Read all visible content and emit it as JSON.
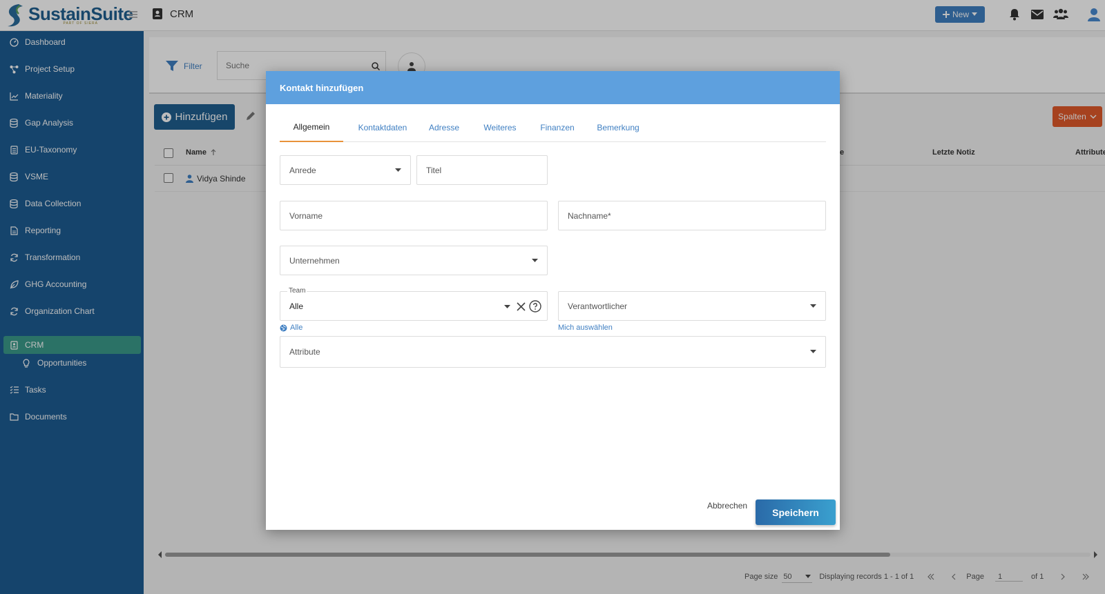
{
  "app": {
    "name": "SustainSuite",
    "tagline": "PART OF SIERA"
  },
  "header": {
    "module": "CRM",
    "new_label": "New"
  },
  "sidebar": {
    "items": [
      {
        "label": "Dashboard"
      },
      {
        "label": "Project Setup"
      },
      {
        "label": "Materiality"
      },
      {
        "label": "Gap Analysis"
      },
      {
        "label": "EU-Taxonomy"
      },
      {
        "label": "VSME"
      },
      {
        "label": "Data Collection"
      },
      {
        "label": "Reporting"
      },
      {
        "label": "Transformation"
      },
      {
        "label": "GHG Accounting"
      },
      {
        "label": "Organization Chart"
      },
      {
        "label": "CRM"
      },
      {
        "label": "Opportunities"
      },
      {
        "label": "Tasks"
      },
      {
        "label": "Documents"
      }
    ]
  },
  "toolbar": {
    "filter_label": "Filter",
    "search_placeholder": "Suche",
    "add_label": "Hinzufügen",
    "columns_label": "Spalten"
  },
  "grid": {
    "columns": [
      "Name",
      "e",
      "Letzte Notiz",
      "Attribute"
    ],
    "rows": [
      {
        "name": "Vidya Shinde"
      }
    ]
  },
  "pager": {
    "page_size_label": "Page size",
    "page_size": "50",
    "records": "Displaying records 1 - 1 of 1",
    "page_label": "Page",
    "page": "1",
    "of": "of 1"
  },
  "modal": {
    "title": "Kontakt hinzufügen",
    "tabs": [
      "Allgemein",
      "Kontaktdaten",
      "Adresse",
      "Weiteres",
      "Finanzen",
      "Bemerkung"
    ],
    "fields": {
      "anrede": "Anrede",
      "titel": "Titel",
      "vorname": "Vorname",
      "nachname": "Nachname*",
      "unternehmen": "Unternehmen",
      "team_label": "Team",
      "team_value": "Alle",
      "team_hint": "Alle",
      "verantwortlicher": "Verantwortlicher",
      "verantwortlicher_hint": "Mich auswählen",
      "attribute": "Attribute"
    },
    "cancel_label": "Abbrechen",
    "save_label": "Speichern"
  },
  "colors": {
    "sidebar": "#1d5c92",
    "active": "#3a9a8a",
    "accent": "#3f7fc2",
    "modal_header": "#5ea0de",
    "spalten": "#e05a2b",
    "tab_underline": "#e8923a"
  }
}
